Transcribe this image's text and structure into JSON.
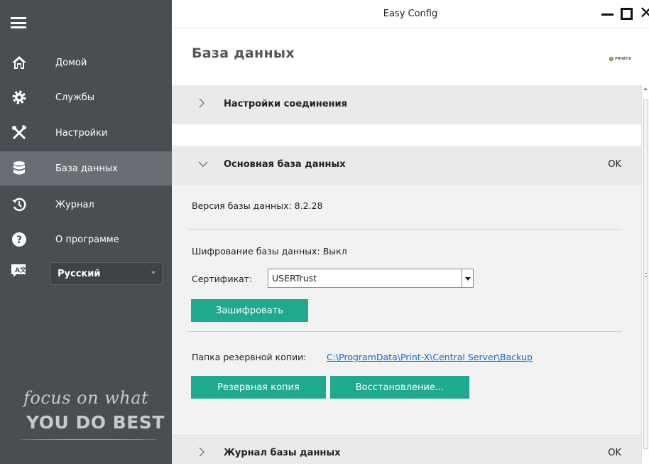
{
  "window": {
    "title": "Easy Config"
  },
  "sidebar": {
    "items": [
      {
        "label": "Домой",
        "icon": "home-icon"
      },
      {
        "label": "Службы",
        "icon": "gear-icon"
      },
      {
        "label": "Настройки",
        "icon": "tools-icon"
      },
      {
        "label": "База данных",
        "icon": "database-icon",
        "active": true
      },
      {
        "label": "Журнал",
        "icon": "history-icon"
      },
      {
        "label": "О программе",
        "icon": "help-icon"
      }
    ],
    "language": {
      "selected": "Русский",
      "icon": "language-icon"
    },
    "slogan": {
      "line1": "focus on what",
      "line2": "YOU DO BEST"
    }
  },
  "page": {
    "title": "База данных",
    "brand": "PRINT-X"
  },
  "sections": {
    "connection": {
      "title": "Настройки соединения"
    },
    "main_db": {
      "title": "Основная база данных",
      "status": "OK",
      "version_label": "Версия базы данных: 8.2.28",
      "encryption_label": "Шифрование базы данных: Выкл",
      "certificate_label": "Сертификат:",
      "certificate_value": "USERTrust",
      "encrypt_button": "Зашифровать",
      "backup_folder_label": "Папка резервной копии:",
      "backup_folder_path": "C:\\ProgramData\\Print-X\\Central Server\\Backup",
      "backup_button": "Резервная копия",
      "restore_button": "Восстановление..."
    },
    "db_log": {
      "title": "Журнал базы данных",
      "status": "OK"
    }
  },
  "colors": {
    "sidebar_bg": "#4a4d52",
    "sidebar_active": "#6a6e74",
    "accent_green": "#1fa98f",
    "section_header_bg": "#e9eaeb",
    "link": "#1a66c4"
  }
}
